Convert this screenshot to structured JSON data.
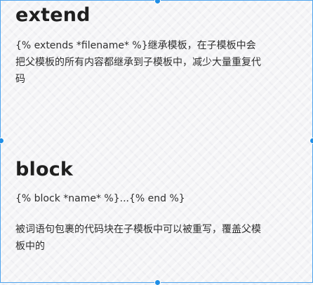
{
  "extend": {
    "heading": "extend",
    "description": "{% extends  *filename* %}继承模板，在子模板中会把父模板的所有内容都继承到子模板中，减少大量重复代码"
  },
  "block": {
    "heading": "block",
    "syntax": "{% block *name* %}...{% end %}",
    "description": "被词语句包裹的代码块在子模板中可以被重写，覆盖父模板中的"
  },
  "accent_color": "#1f8ee6",
  "icons": [
    "resize-handle-top",
    "resize-handle-bottom",
    "resize-handle-left",
    "resize-handle-right"
  ]
}
